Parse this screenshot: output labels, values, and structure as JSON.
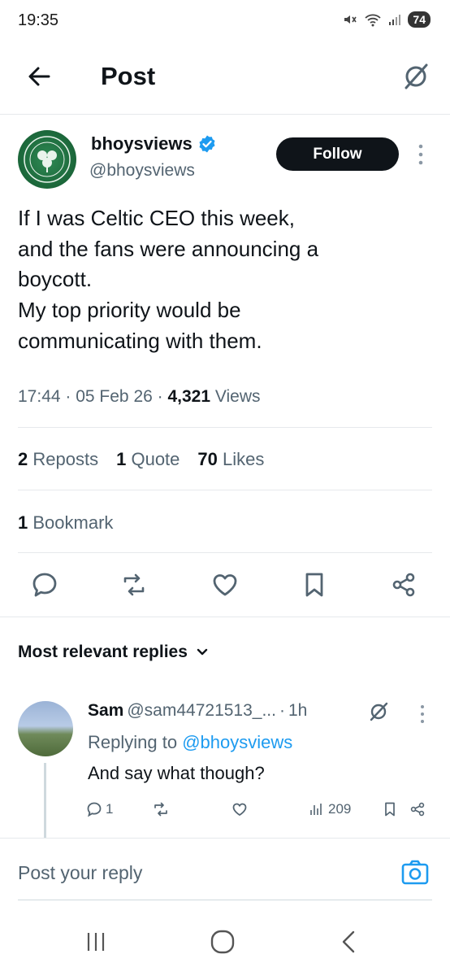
{
  "status_bar": {
    "time": "19:35",
    "battery": "74"
  },
  "header": {
    "title": "Post"
  },
  "author": {
    "name": "bhoysviews",
    "handle": "@bhoysviews",
    "follow_label": "Follow"
  },
  "tweet": {
    "text": "If I was Celtic CEO this week,\nand the fans were announcing a\nboycott.\nMy top priority would be\ncommunicating with them.",
    "time": "17:44",
    "date": "05 Feb 26",
    "views_count": "4,321",
    "views_label": "Views"
  },
  "stats": {
    "reposts_count": "2",
    "reposts_label": "Reposts",
    "quotes_count": "1",
    "quotes_label": "Quote",
    "likes_count": "70",
    "likes_label": "Likes",
    "bookmarks_count": "1",
    "bookmarks_label": "Bookmark"
  },
  "replies_section": {
    "label": "Most relevant replies"
  },
  "reply": {
    "name": "Sam",
    "handle": "@sam44721513_...",
    "age": "1h",
    "replying_prefix": "Replying to",
    "replying_to": "@bhoysviews",
    "text": "And say what though?",
    "reply_count": "1",
    "views": "209"
  },
  "composer": {
    "placeholder": "Post your reply"
  },
  "colors": {
    "accent": "#1d9bf0",
    "text": "#0f1419",
    "secondary": "#536471",
    "celtic_green": "#1f6e3f"
  },
  "icons": [
    "back-arrow-icon",
    "grok-icon",
    "verified-badge-icon",
    "more-vertical-icon",
    "reply-icon",
    "repost-icon",
    "like-icon",
    "bookmark-icon",
    "share-icon",
    "chevron-down-icon",
    "views-icon",
    "camera-icon"
  ]
}
